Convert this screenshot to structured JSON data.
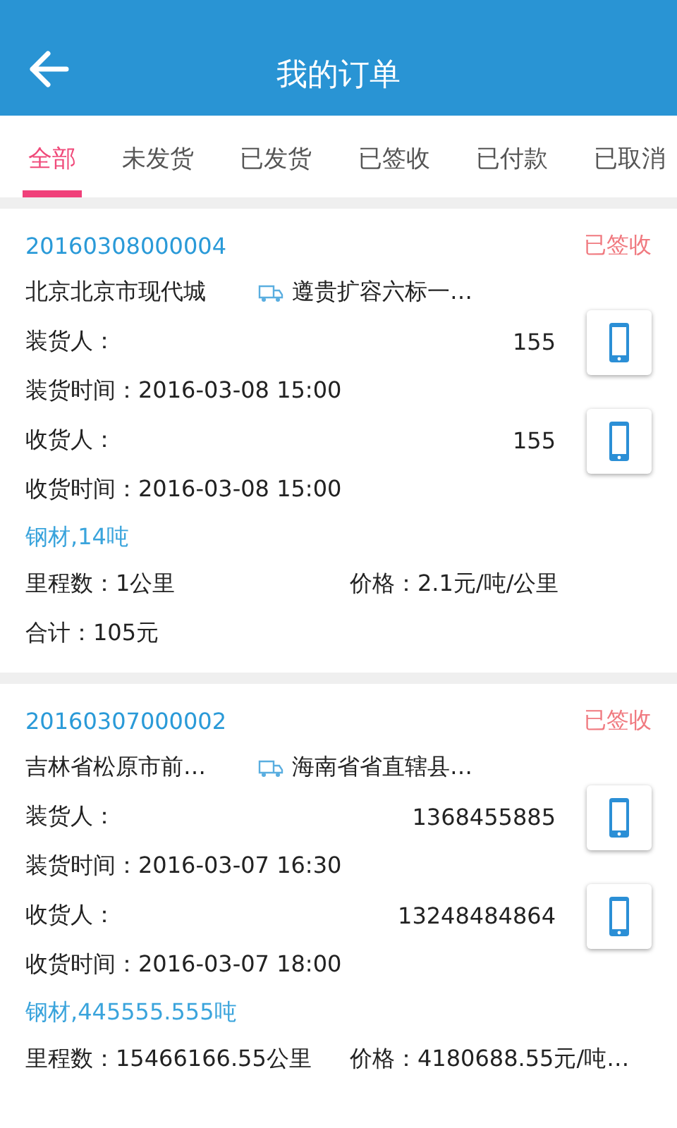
{
  "header": {
    "title": "我的订单"
  },
  "tabs": [
    {
      "label": "全部",
      "selected": true
    },
    {
      "label": "未发货",
      "selected": false
    },
    {
      "label": "已发货",
      "selected": false
    },
    {
      "label": "已签收",
      "selected": false
    },
    {
      "label": "已付款",
      "selected": false
    },
    {
      "label": "已取消",
      "selected": false
    }
  ],
  "orders": [
    {
      "order_no": "20160308000004",
      "status": "已签收",
      "origin": "北京北京市现代城",
      "destination": "遵贵扩容六标一…",
      "loader_label": "装货人：",
      "loader_phone": "155",
      "load_time": "装货时间：2016-03-08 15:00",
      "receiver_label": "收货人：",
      "receiver_phone": "155",
      "receive_time": "收货时间：2016-03-08 15:00",
      "cargo": "钢材,14吨",
      "mileage": "里程数：1公里",
      "price": "价格：2.1元/吨/公里",
      "total": "合计：105元"
    },
    {
      "order_no": "20160307000002",
      "status": "已签收",
      "origin": "吉林省松原市前…",
      "destination": "海南省省直辖县…",
      "loader_label": "装货人：",
      "loader_phone": "1368455885",
      "load_time": "装货时间：2016-03-07 16:30",
      "receiver_label": "收货人：",
      "receiver_phone": "13248484864",
      "receive_time": "收货时间：2016-03-07 18:00",
      "cargo": "钢材,445555.555吨",
      "mileage": "里程数：15466166.55公里",
      "price": "价格：4180688.55元/吨…"
    }
  ]
}
